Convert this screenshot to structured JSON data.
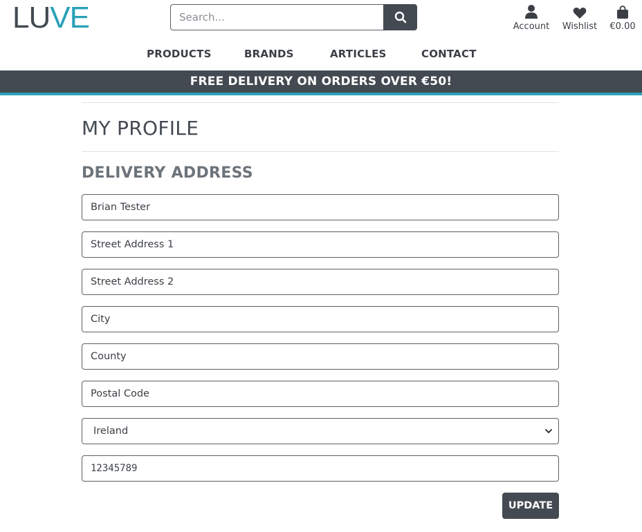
{
  "brand": {
    "logo_part1": "LU",
    "logo_part2": "VE",
    "accent": "#2aa1b8",
    "dark": "#444a52"
  },
  "search": {
    "placeholder": "Search...",
    "icon": "search-icon"
  },
  "header_icons": [
    {
      "label": "Account",
      "icon": "user-icon"
    },
    {
      "label": "Wishlist",
      "icon": "heart-icon"
    },
    {
      "label": "€0.00",
      "icon": "shopping-bag-icon"
    }
  ],
  "nav": {
    "products": "PRODUCTS",
    "brands": "BRANDS",
    "articles": "ARTICLES",
    "contact": "CONTACT"
  },
  "banner": {
    "text": "FREE DELIVERY ON ORDERS OVER €50!"
  },
  "page": {
    "title": "MY PROFILE",
    "section_title": "DELIVERY ADDRESS"
  },
  "form": {
    "full_name": {
      "value": "Brian Tester"
    },
    "street1": {
      "placeholder": "Street Address 1"
    },
    "street2": {
      "placeholder": "Street Address 2"
    },
    "city": {
      "placeholder": "City"
    },
    "county": {
      "placeholder": "County"
    },
    "postcode": {
      "placeholder": "Postal Code"
    },
    "country": {
      "selected": "Ireland",
      "icon": "chevron-down-icon"
    },
    "phone": {
      "value": "12345789"
    },
    "submit_label": "UPDATE"
  }
}
